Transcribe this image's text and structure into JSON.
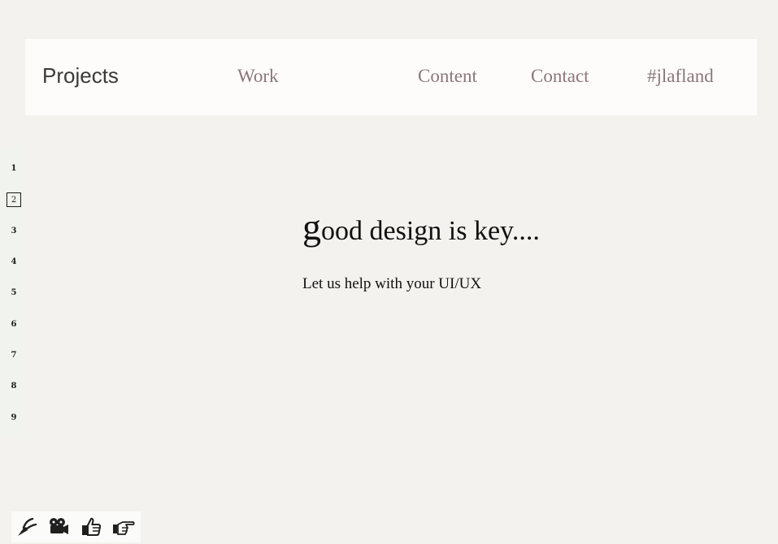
{
  "header": {
    "brand": "Projects",
    "nav": [
      {
        "label": "Work"
      },
      {
        "label": "Content"
      },
      {
        "label": "Contact"
      },
      {
        "label": "#jlafland"
      }
    ]
  },
  "sidenav": {
    "pages": [
      "1",
      "2",
      "3",
      "4",
      "5",
      "6",
      "7",
      "8",
      "9"
    ],
    "active": "2"
  },
  "main": {
    "headline_initial": "g",
    "headline_rest": "ood design is key....",
    "subline": "Let us help with your UI/UX"
  },
  "toolbar": {
    "icons": [
      "pliers-icon",
      "camera-icon",
      "thumbs-up-icon",
      "pointing-hand-icon"
    ]
  }
}
